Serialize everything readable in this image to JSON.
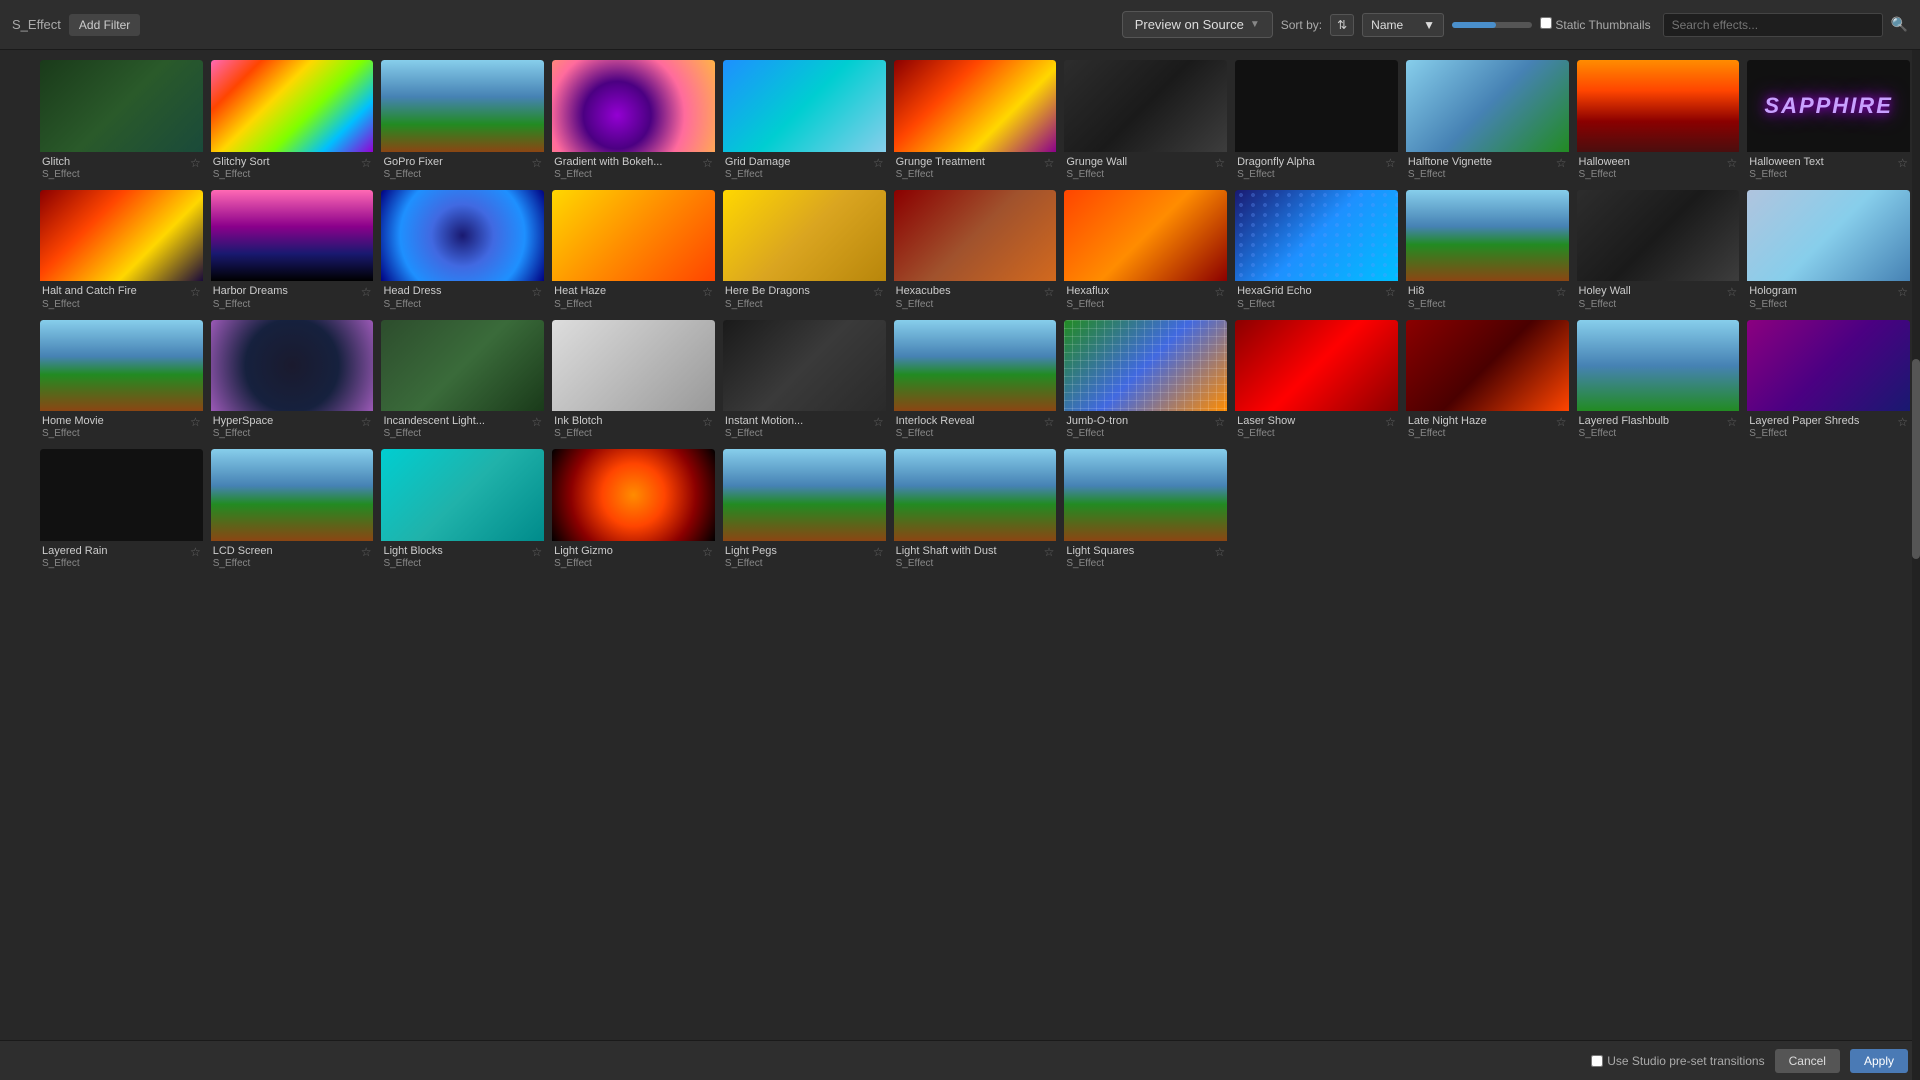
{
  "topbar": {
    "effect_label": "S_Effect",
    "add_filter": "Add Filter",
    "preview_source": "Preview on Source",
    "sort_by": "Sort by:",
    "name_label": "Name",
    "static_thumbnails": "Static Thumbnails",
    "search_placeholder": "Search effects..."
  },
  "bottombar": {
    "checkbox_label": "Use Studio pre-set transitions",
    "cancel": "Cancel",
    "apply": "Apply"
  },
  "effects": [
    {
      "name": "Glitch",
      "type": "S_Effect",
      "thumb": "thumb-glitch",
      "row": 0
    },
    {
      "name": "Glitchy Sort",
      "type": "S_Effect",
      "thumb": "thumb-glitchy-sort",
      "row": 0
    },
    {
      "name": "GoPro Fixer",
      "type": "S_Effect",
      "thumb": "thumb-gopro",
      "row": 0
    },
    {
      "name": "Gradient with Bokeh...",
      "type": "S_Effect",
      "thumb": "thumb-gradient-bokeh",
      "row": 0
    },
    {
      "name": "Grid Damage",
      "type": "S_Effect",
      "thumb": "thumb-grid-damage",
      "row": 0
    },
    {
      "name": "Grunge Treatment",
      "type": "S_Effect",
      "thumb": "thumb-grunge",
      "row": 0
    },
    {
      "name": "Grunge Wall",
      "type": "S_Effect",
      "thumb": "thumb-grunge-wall",
      "row": 0
    },
    {
      "name": "Dragonfly Alpha",
      "type": "S_Effect",
      "thumb": "thumb-dragonfly",
      "row": 0
    },
    {
      "name": "Halftone Vignette",
      "type": "S_Effect",
      "thumb": "thumb-halftone",
      "row": 1
    },
    {
      "name": "Halloween",
      "type": "S_Effect",
      "thumb": "thumb-halloween",
      "row": 1
    },
    {
      "name": "Halloween Text",
      "type": "S_Effect",
      "thumb": "thumb-sapphire-text",
      "row": 1
    },
    {
      "name": "Halt and Catch Fire",
      "type": "S_Effect",
      "thumb": "thumb-halt-fire",
      "row": 1
    },
    {
      "name": "Harbor Dreams",
      "type": "S_Effect",
      "thumb": "thumb-harbor",
      "row": 1
    },
    {
      "name": "Head Dress",
      "type": "S_Effect",
      "thumb": "thumb-head-dress",
      "row": 1
    },
    {
      "name": "Heat Haze",
      "type": "S_Effect",
      "thumb": "thumb-heat-haze",
      "row": 1
    },
    {
      "name": "Here Be Dragons",
      "type": "S_Effect",
      "thumb": "thumb-here-dragons",
      "row": 1
    },
    {
      "name": "Hexacubes",
      "type": "S_Effect",
      "thumb": "thumb-hexacubes",
      "row": 2
    },
    {
      "name": "Hexaflux",
      "type": "S_Effect",
      "thumb": "thumb-hexaflux",
      "row": 2
    },
    {
      "name": "HexaGrid Echo",
      "type": "S_Effect",
      "thumb": "thumb-hexagrid",
      "row": 2
    },
    {
      "name": "Hi8",
      "type": "S_Effect",
      "thumb": "thumb-hi8",
      "row": 2
    },
    {
      "name": "Holey Wall",
      "type": "S_Effect",
      "thumb": "thumb-holey-wall",
      "row": 2
    },
    {
      "name": "Hologram",
      "type": "S_Effect",
      "thumb": "thumb-hologram",
      "row": 2
    },
    {
      "name": "Home Movie",
      "type": "S_Effect",
      "thumb": "thumb-home-movie",
      "row": 2
    },
    {
      "name": "HyperSpace",
      "type": "S_Effect",
      "thumb": "thumb-hyperspace",
      "row": 2
    },
    {
      "name": "Incandescent Light...",
      "type": "S_Effect",
      "thumb": "thumb-incandescent",
      "row": 3
    },
    {
      "name": "Ink Blotch",
      "type": "S_Effect",
      "thumb": "thumb-ink-blotch",
      "row": 3
    },
    {
      "name": "Instant Motion...",
      "type": "S_Effect",
      "thumb": "thumb-instant-motion",
      "row": 3
    },
    {
      "name": "Interlock Reveal",
      "type": "S_Effect",
      "thumb": "thumb-interlock",
      "row": 3
    },
    {
      "name": "Jumb-O-tron",
      "type": "S_Effect",
      "thumb": "thumb-jumb-o-tron",
      "row": 3
    },
    {
      "name": "Laser Show",
      "type": "S_Effect",
      "thumb": "thumb-laser-show",
      "row": 3
    },
    {
      "name": "Late Night Haze",
      "type": "S_Effect",
      "thumb": "thumb-late-night",
      "row": 3
    },
    {
      "name": "Layered Flashbulb",
      "type": "S_Effect",
      "thumb": "thumb-layered-flash",
      "row": 3
    },
    {
      "name": "Layered Paper Shreds",
      "type": "S_Effect",
      "thumb": "thumb-layered-paper",
      "row": 4
    },
    {
      "name": "Layered Rain",
      "type": "S_Effect",
      "thumb": "thumb-layered-rain",
      "row": 4
    },
    {
      "name": "LCD Screen",
      "type": "S_Effect",
      "thumb": "thumb-lcd-screen",
      "row": 4
    },
    {
      "name": "Light Blocks",
      "type": "S_Effect",
      "thumb": "thumb-light-blocks",
      "row": 4
    },
    {
      "name": "Light Gizmo",
      "type": "S_Effect",
      "thumb": "thumb-light-gizmo",
      "row": 4
    },
    {
      "name": "Light Pegs",
      "type": "S_Effect",
      "thumb": "thumb-light-pegs",
      "row": 4
    },
    {
      "name": "Light Shaft with Dust",
      "type": "S_Effect",
      "thumb": "thumb-light-shaft",
      "row": 4
    },
    {
      "name": "Light Squares",
      "type": "S_Effect",
      "thumb": "thumb-light-squares",
      "row": 4
    }
  ]
}
